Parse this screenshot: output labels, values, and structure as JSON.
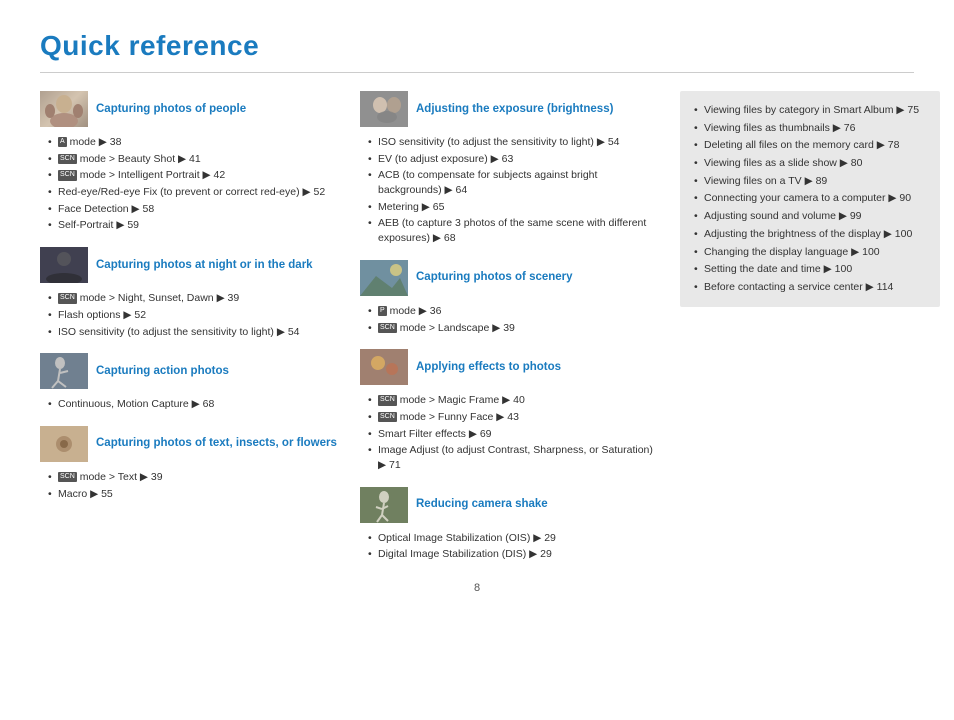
{
  "page": {
    "title": "Quick reference",
    "page_number": "8"
  },
  "sections": {
    "left": [
      {
        "id": "people",
        "title": "Capturing photos of people",
        "thumb_class": "thumb-people",
        "items": [
          "<span class='icon-mode'>A</span> mode ▶ 38",
          "<span class='icon-mode'>SCN</span> mode > Beauty Shot ▶ 41",
          "<span class='icon-mode'>SCN</span> mode > Intelligent Portrait ▶ 42",
          "Red-eye/Red-eye Fix (to prevent or correct red-eye) ▶ 52",
          "Face Detection ▶ 58",
          "Self-Portrait ▶ 59"
        ]
      },
      {
        "id": "night",
        "title": "Capturing photos at night or in the dark",
        "thumb_class": "thumb-night",
        "items": [
          "<span class='icon-mode'>SCN</span> mode > Night, Sunset, Dawn ▶ 39",
          "Flash options ▶ 52",
          "ISO sensitivity (to adjust the sensitivity to light) ▶ 54"
        ]
      },
      {
        "id": "action",
        "title": "Capturing action photos",
        "thumb_class": "thumb-action",
        "items": [
          "Continuous, Motion Capture ▶ 68"
        ]
      },
      {
        "id": "text",
        "title": "Capturing photos of text, insects, or flowers",
        "thumb_class": "thumb-text",
        "items": [
          "<span class='icon-mode'>SCN</span> mode > Text ▶ 39",
          "Macro ▶ 55"
        ]
      }
    ],
    "mid": [
      {
        "id": "exposure",
        "title": "Adjusting the exposure (brightness)",
        "thumb_class": "thumb-exposure",
        "items": [
          "ISO sensitivity (to adjust the sensitivity to light) ▶ 54",
          "EV (to adjust exposure) ▶ 63",
          "ACB (to compensate for subjects against bright backgrounds) ▶ 64",
          "Metering ▶ 65",
          "AEB (to capture 3 photos of the same scene with different exposures) ▶ 68"
        ]
      },
      {
        "id": "scenery",
        "title": "Capturing photos of scenery",
        "thumb_class": "thumb-scenery",
        "items": [
          "<span class='icon-mode'>p</span> mode ▶ 36",
          "<span class='icon-mode'>SCN</span> mode > Landscape ▶ 39"
        ]
      },
      {
        "id": "effects",
        "title": "Applying effects to photos",
        "thumb_class": "thumb-effects",
        "items": [
          "<span class='icon-mode'>SCN</span> mode > Magic Frame ▶ 40",
          "<span class='icon-mode'>SCN</span> mode > Funny Face ▶ 43",
          "Smart Filter effects ▶ 69",
          "Image Adjust (to adjust Contrast, Sharpness, or Saturation) ▶ 71"
        ]
      },
      {
        "id": "shake",
        "title": "Reducing camera shake",
        "thumb_class": "thumb-shake",
        "items": [
          "Optical Image Stabilization (OIS) ▶ 29",
          "Digital Image Stabilization (DIS) ▶ 29"
        ]
      }
    ],
    "right_items": [
      "Viewing files by category in Smart Album ▶ 75",
      "Viewing files as thumbnails ▶ 76",
      "Deleting all files on the memory card ▶ 78",
      "Viewing files as a slide show ▶ 80",
      "Viewing files on a TV ▶ 89",
      "Connecting your camera to a computer ▶ 90",
      "Adjusting sound and volume ▶ 99",
      "Adjusting the brightness of the display ▶ 100",
      "Changing the display language ▶ 100",
      "Setting the date and time ▶ 100",
      "Before contacting a service center ▶ 114"
    ]
  }
}
